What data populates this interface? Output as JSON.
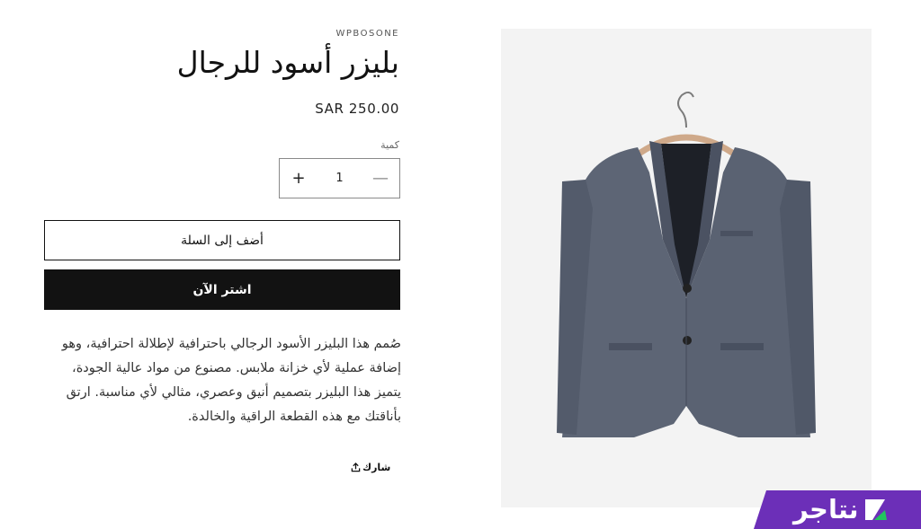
{
  "product": {
    "vendor": "WPBOSONE",
    "title": "بليزر أسود للرجال",
    "price": "SAR 250.00",
    "quantity_label": "كمية",
    "quantity_value": "1",
    "decrease_icon": "minus-icon",
    "increase_icon": "plus-icon",
    "add_to_cart_label": "أضف إلى السلة",
    "buy_now_label": "اشتر الآن",
    "description": "صُمم هذا البليزر الأسود الرجالي باحترافية لإطلالة احترافية، وهو إضافة عملية لأي خزانة ملابس. مصنوع من مواد عالية الجودة، يتميز هذا البليزر بتصميم أنيق وعصري، مثالي لأي مناسبة. ارتق بأناقتك مع هذه القطعة الراقية والخالدة.",
    "share_label": "شارك",
    "share_icon": "share-icon",
    "image_alt": "grey blazer on hanger"
  },
  "brand_badge": {
    "text": "نتاجر",
    "color": "#6c2fb8",
    "icon": "logo-icon"
  },
  "colors": {
    "primary": "#121212",
    "blazer": "#5d6575",
    "media_background": "#f3f3f3"
  }
}
